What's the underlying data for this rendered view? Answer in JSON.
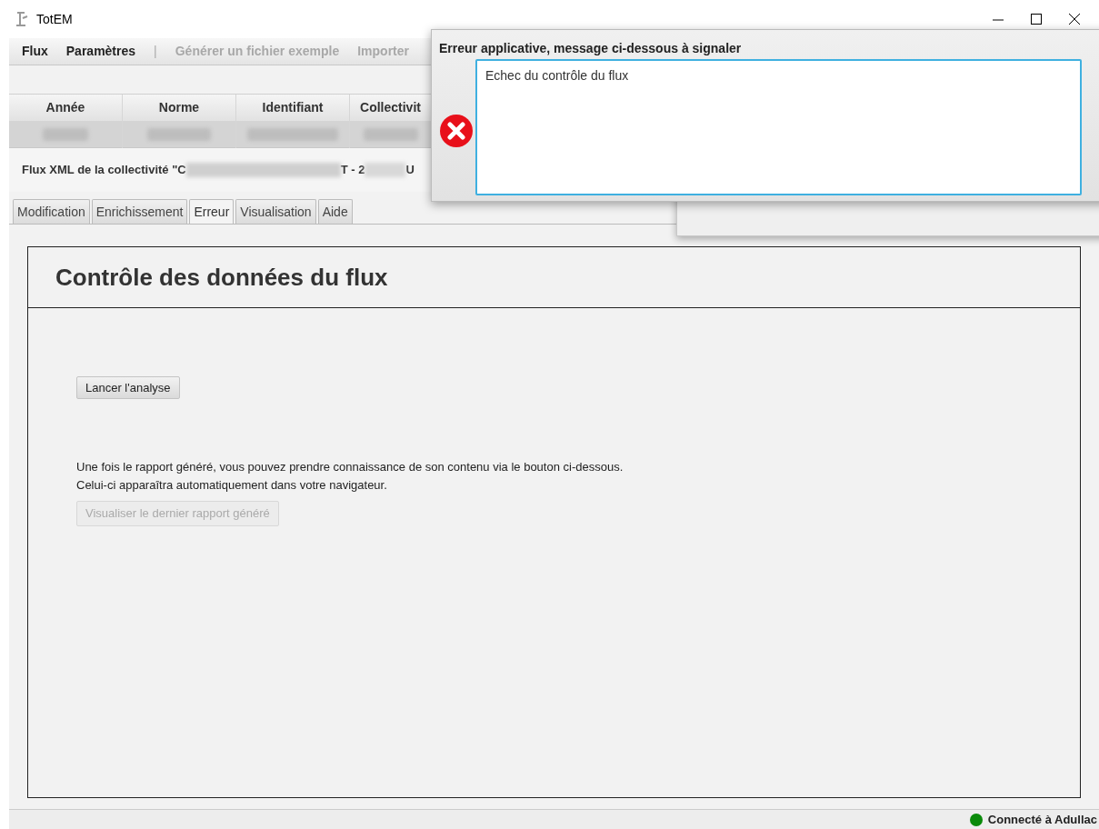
{
  "window": {
    "title": "TotEM"
  },
  "menu": [
    {
      "label": "Flux",
      "disabled": false
    },
    {
      "label": "Paramètres",
      "disabled": false
    },
    {
      "label": "|",
      "kind": "separator"
    },
    {
      "label": "Générer un fichier exemple",
      "disabled": true
    },
    {
      "label": "Importer",
      "disabled": true
    }
  ],
  "table": {
    "columns": [
      "Année",
      "Norme",
      "Identifiant",
      "Collectivit"
    ]
  },
  "flux_label": [
    "Flux XML de la collectivité \"C",
    "T - 2",
    "U"
  ],
  "tabs": [
    {
      "label": "Modification",
      "selected": false
    },
    {
      "label": "Enrichissement",
      "selected": false
    },
    {
      "label": "Erreur",
      "selected": true
    },
    {
      "label": "Visualisation",
      "selected": false
    },
    {
      "label": "Aide",
      "selected": false
    }
  ],
  "panel": {
    "title": "Contrôle des données du flux",
    "analyse_button": {
      "label": "Lancer l'analyse",
      "disabled": false
    },
    "info": [
      "Une fois le rapport généré, vous pouvez prendre connaissance de son contenu via le bouton ci-dessous.",
      "Celui-ci apparaîtra automatiquement dans votre navigateur."
    ],
    "report_button": {
      "label": "Visualiser le dernier rapport généré",
      "disabled": true
    }
  },
  "status_bar": {
    "text": "Connecté à Adullac",
    "color": "#0a8a0a"
  },
  "dialog": {
    "title": "Erreur applicative, message ci-dessous à signaler",
    "message": "Echec du contrôle du flux"
  }
}
